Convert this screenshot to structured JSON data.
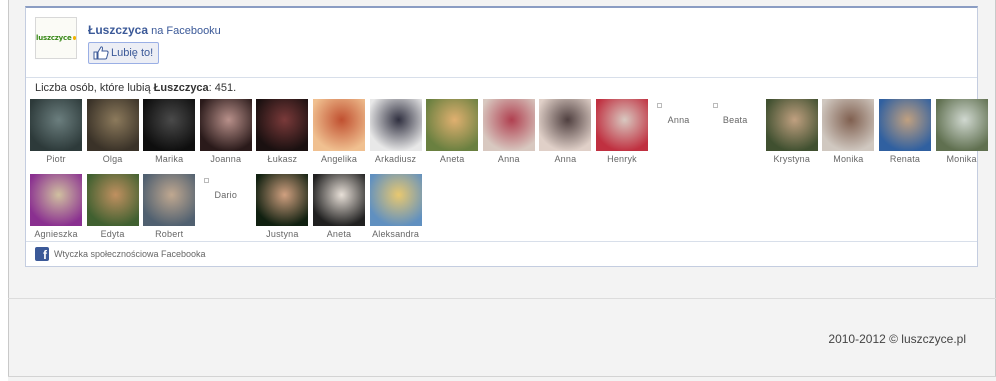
{
  "widget": {
    "page_name": "Łuszczyca",
    "page_suffix": " na Facebooku",
    "logo_text": "luszczyce",
    "like_button_label": "Lubię to!",
    "like_count_prefix": "Liczba osób, które lubią ",
    "like_count_page": "Łuszczyca",
    "like_count_suffix": ": 451.",
    "footer_text": "Wtyczka społecznościowa Facebooka"
  },
  "fans": [
    {
      "name": "Piotr",
      "photo": true,
      "colors": [
        "#2d3a3a",
        "#6b7e7e"
      ]
    },
    {
      "name": "Olga",
      "photo": true,
      "colors": [
        "#3a3228",
        "#8c7a5c"
      ]
    },
    {
      "name": "Marika",
      "photo": true,
      "colors": [
        "#0e0e0e",
        "#4a4a4a"
      ]
    },
    {
      "name": "Joanna",
      "photo": true,
      "colors": [
        "#2a1a1a",
        "#b8908a"
      ]
    },
    {
      "name": "Łukasz",
      "photo": true,
      "colors": [
        "#1a1010",
        "#7a3a3a"
      ]
    },
    {
      "name": "Angelika",
      "photo": true,
      "colors": [
        "#f0c090",
        "#c05030"
      ]
    },
    {
      "name": "Arkadiusz",
      "photo": true,
      "colors": [
        "#e8e8e8",
        "#303040"
      ]
    },
    {
      "name": "Aneta",
      "photo": true,
      "colors": [
        "#6a8040",
        "#e0b070"
      ]
    },
    {
      "name": "Anna",
      "photo": true,
      "colors": [
        "#d8c8c0",
        "#b04050"
      ]
    },
    {
      "name": "Anna",
      "photo": true,
      "colors": [
        "#e0d0c8",
        "#504040"
      ]
    },
    {
      "name": "Henryk",
      "photo": true,
      "colors": [
        "#c03040",
        "#d8c8c0"
      ]
    },
    {
      "name": "Anna",
      "photo": false
    },
    {
      "name": "Beata",
      "photo": false
    },
    {
      "name": "Krystyna",
      "photo": true,
      "colors": [
        "#405030",
        "#c0a080"
      ]
    },
    {
      "name": "Monika",
      "photo": true,
      "colors": [
        "#d0c8c0",
        "#806050"
      ]
    },
    {
      "name": "Renata",
      "photo": true,
      "colors": [
        "#3060a0",
        "#c0a080"
      ]
    },
    {
      "name": "Monika",
      "photo": true,
      "colors": [
        "#607050",
        "#d0d8d0"
      ]
    },
    {
      "name": "Agnieszka",
      "photo": true,
      "colors": [
        "#8a3090",
        "#d0c0a0"
      ]
    },
    {
      "name": "Edyta",
      "photo": true,
      "colors": [
        "#406030",
        "#c09060"
      ]
    },
    {
      "name": "Robert",
      "photo": true,
      "colors": [
        "#506070",
        "#c0a890"
      ]
    },
    {
      "name": "Dario",
      "photo": false
    },
    {
      "name": "Justyna",
      "photo": true,
      "colors": [
        "#102010",
        "#d0a080"
      ]
    },
    {
      "name": "Aneta",
      "photo": true,
      "colors": [
        "#202020",
        "#e8e0d8"
      ]
    },
    {
      "name": "Aleksandra",
      "photo": true,
      "colors": [
        "#6090c0",
        "#e8c870"
      ]
    }
  ],
  "footer": {
    "copyright": "2010-2012 © luszczyce.pl"
  }
}
